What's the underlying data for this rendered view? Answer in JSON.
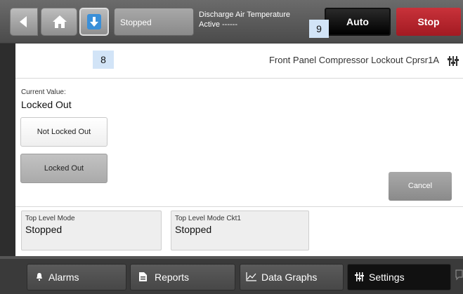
{
  "topbar": {
    "status": "Stopped",
    "discharge_label": "Discharge Air Temperature",
    "discharge_value": "Active ------",
    "auto_label": "Auto",
    "stop_label": "Stop"
  },
  "markers": {
    "m9": "9",
    "m8": "8"
  },
  "panel": {
    "title": "Front Panel Compressor Lockout Cprsr1A",
    "current_value_label": "Current Value:",
    "current_value": "Locked Out",
    "options": [
      "Not Locked Out",
      "Locked Out"
    ],
    "selected_option": "Locked Out",
    "cancel_label": "Cancel",
    "info": [
      {
        "label": "Top Level Mode",
        "value": "Stopped"
      },
      {
        "label": "Top Level Mode Ckt1",
        "value": "Stopped"
      }
    ]
  },
  "bottom_tabs": [
    {
      "label": "Alarms",
      "icon": "bell-icon"
    },
    {
      "label": "Reports",
      "icon": "document-icon"
    },
    {
      "label": "Data Graphs",
      "icon": "graph-icon"
    },
    {
      "label": "Settings",
      "icon": "settings-sliders-icon",
      "active": true
    }
  ],
  "colors": {
    "stop": "#b8232b",
    "accent_blue": "#3a8fd8",
    "active_tab": "#111111"
  }
}
